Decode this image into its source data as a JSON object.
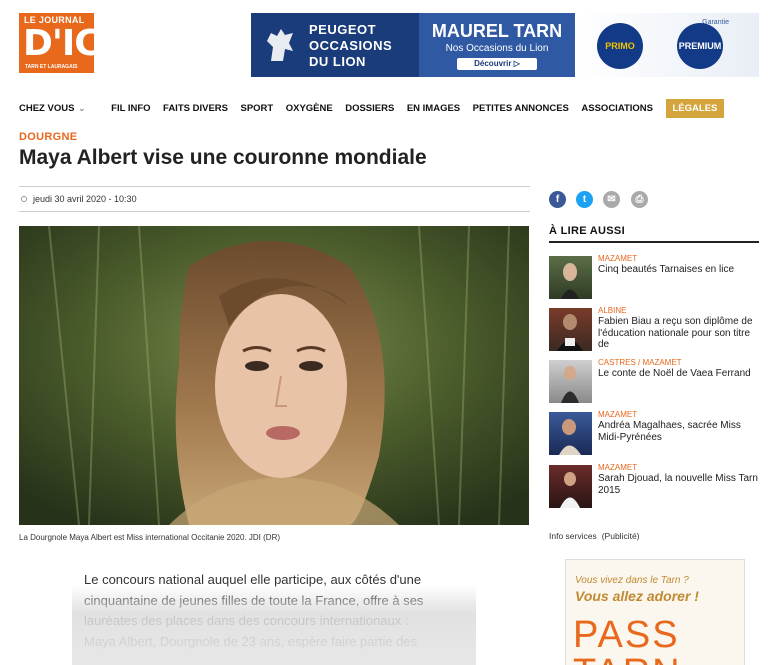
{
  "header": {
    "logo": {
      "line1": "LE JOURNAL",
      "line2": "D'ICI",
      "line3": "TARN ET LAURAGAIS"
    },
    "ad": {
      "brand": "PEUGEOT",
      "line2": "OCCASIONS",
      "line3": "DU LION",
      "dealer": "MAUREL TARN",
      "tagline": "Nos Occasions du Lion",
      "cta": "Découvrir ▷",
      "garantie": "Garantie",
      "primo": "PRIMO",
      "premium": "PREMIUM"
    }
  },
  "nav": {
    "items": [
      {
        "label": "CHEZ VOUS"
      },
      {
        "label": "FIL INFO"
      },
      {
        "label": "FAITS DIVERS"
      },
      {
        "label": "SPORT"
      },
      {
        "label": "OXYGÈNE"
      },
      {
        "label": "DOSSIERS"
      },
      {
        "label": "EN IMAGES"
      },
      {
        "label": "PETITES ANNONCES"
      },
      {
        "label": "ASSOCIATIONS"
      },
      {
        "label": "LÉGALES"
      }
    ]
  },
  "article": {
    "kicker": "DOURGNE",
    "title": "Maya Albert vise une couronne mondiale",
    "date": "jeudi 30 avril 2020 - 10:30",
    "caption": "La Dourgnole Maya Albert est Miss international Occitanie 2020. JDI (DR)",
    "body": [
      "Le concours national auquel elle participe, aux côtés d'une",
      "cinquantaine de jeunes filles de toute la France, offre à ses",
      "lauréates des places dans des concours internationaux :",
      "Maya Albert, Dourgnole de 23 ans, espère faire partie des"
    ]
  },
  "share": {
    "facebook": "f",
    "twitter": "t",
    "mail": "✉",
    "print": "⎙"
  },
  "sidebar": {
    "title": "À LIRE AUSSI",
    "items": [
      {
        "category": "MAZAMET",
        "headline": "Cinq beautés Tarnaises en lice"
      },
      {
        "category": "ALBINE",
        "headline": "Fabien Biau a reçu son diplôme de l'éducation nationale pour son titre de"
      },
      {
        "category": "CASTRES / MAZAMET",
        "headline": "Le conte de Noël de Vaea Ferrand"
      },
      {
        "category": "MAZAMET",
        "headline": "Andréa Magalhaes, sacrée Miss Midi-Pyrénées"
      },
      {
        "category": "MAZAMET",
        "headline": "Sarah Djouad, la nouvelle Miss Tarn 2015"
      }
    ],
    "info_services": "Info services",
    "publicite": "(Publicité)",
    "pass_ad": {
      "line1": "Vous vivez dans le Tarn ?",
      "line2": "Vous allez adorer !",
      "pass": "PASS",
      "tarn": "TARN"
    }
  }
}
